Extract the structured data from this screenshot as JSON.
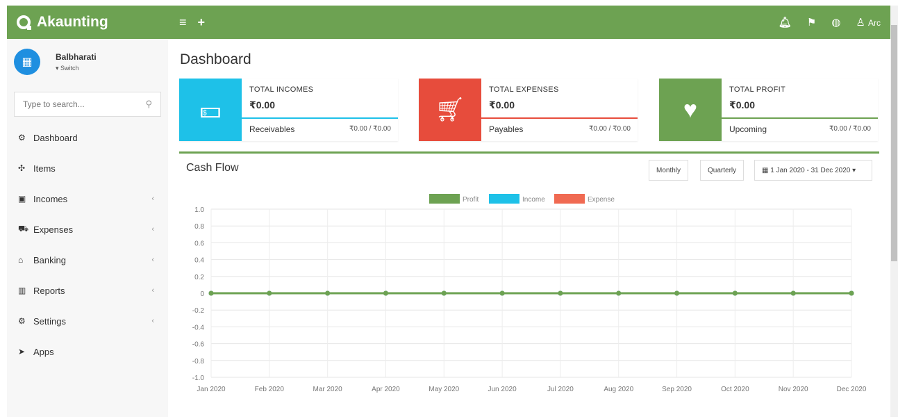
{
  "brand": {
    "name": "Akaunting"
  },
  "topbar": {
    "menu_icon": "≡",
    "add_icon": "+",
    "user_label": "Arc"
  },
  "company": {
    "name": "Balbharati",
    "switch_label": "▾ Switch"
  },
  "search": {
    "placeholder": "Type to search..."
  },
  "sidebar": {
    "items": [
      {
        "label": "Dashboard",
        "icon": "dashboard-icon",
        "glyph": "⚙",
        "chevron": ""
      },
      {
        "label": "Items",
        "icon": "items-icon",
        "glyph": "✣",
        "chevron": ""
      },
      {
        "label": "Incomes",
        "icon": "incomes-icon",
        "glyph": "▣",
        "chevron": "‹"
      },
      {
        "label": "Expenses",
        "icon": "expenses-icon",
        "glyph": "⛟",
        "chevron": "‹"
      },
      {
        "label": "Banking",
        "icon": "banking-icon",
        "glyph": "⌂",
        "chevron": "‹"
      },
      {
        "label": "Reports",
        "icon": "reports-icon",
        "glyph": "▥",
        "chevron": "‹"
      },
      {
        "label": "Settings",
        "icon": "settings-icon",
        "glyph": "⚙",
        "chevron": "‹"
      },
      {
        "label": "Apps",
        "icon": "apps-icon",
        "glyph": "➤",
        "chevron": ""
      }
    ]
  },
  "page": {
    "title": "Dashboard"
  },
  "cards": [
    {
      "title": "TOTAL INCOMES",
      "amount": "₹0.00",
      "sub": "Receivables",
      "value": "₹0.00 / ₹0.00",
      "color": "#1ec1e8",
      "icon": "money-icon"
    },
    {
      "title": "TOTAL EXPENSES",
      "amount": "₹0.00",
      "sub": "Payables",
      "value": "₹0.00 / ₹0.00",
      "color": "#e74c3c",
      "icon": "cart-icon"
    },
    {
      "title": "TOTAL PROFIT",
      "amount": "₹0.00",
      "sub": "Upcoming",
      "value": "₹0.00 / ₹0.00",
      "color": "#6da252",
      "icon": "heart-icon"
    }
  ],
  "cashflow": {
    "title": "Cash Flow",
    "monthly_label": "Monthly",
    "quarterly_label": "Quarterly",
    "date_range": "1 Jan 2020 - 31 Dec 2020"
  },
  "chart_data": {
    "type": "line",
    "title": "",
    "x": [
      "Jan 2020",
      "Feb 2020",
      "Mar 2020",
      "Apr 2020",
      "May 2020",
      "Jun 2020",
      "Jul 2020",
      "Aug 2020",
      "Sep 2020",
      "Oct 2020",
      "Nov 2020",
      "Dec 2020"
    ],
    "yticks": [
      "1.0",
      "0.8",
      "0.6",
      "0.4",
      "0.2",
      "0",
      "-0.2",
      "-0.4",
      "-0.6",
      "-0.8",
      "-1.0"
    ],
    "ylim": [
      -1.0,
      1.0
    ],
    "grid": true,
    "legend": "top-center",
    "series": [
      {
        "name": "Profit",
        "color": "#6da252",
        "values": [
          0,
          0,
          0,
          0,
          0,
          0,
          0,
          0,
          0,
          0,
          0,
          0
        ]
      },
      {
        "name": "Income",
        "color": "#1ec1e8",
        "values": [
          0,
          0,
          0,
          0,
          0,
          0,
          0,
          0,
          0,
          0,
          0,
          0
        ]
      },
      {
        "name": "Expense",
        "color": "#f06a52",
        "values": [
          0,
          0,
          0,
          0,
          0,
          0,
          0,
          0,
          0,
          0,
          0,
          0
        ]
      }
    ]
  }
}
